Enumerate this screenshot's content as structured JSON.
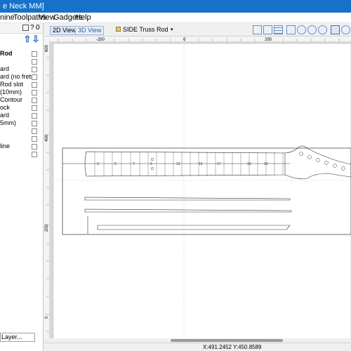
{
  "window": {
    "title": "e Neck MM]"
  },
  "menu": {
    "items": [
      "nine",
      "Toolpaths",
      "View",
      "Gadgets",
      "Help"
    ]
  },
  "sidebar": {
    "toolbar_question": "?",
    "toolbar_icon2": "0",
    "up_arrow": "⇧",
    "down_arrow": "⇩",
    "layers": [
      "Rod",
      "",
      "ard",
      "ard (no frets)",
      "Rod slot",
      "(10mm)",
      "Contour",
      "ock",
      "ard",
      "5mm)",
      "",
      "",
      "line",
      ""
    ],
    "bottom_button": "Layer..."
  },
  "view": {
    "tabs": [
      "2D View",
      "3D View"
    ],
    "layer_select": "SIDE Truss Rod"
  },
  "ruler": {
    "top_labels": [
      "-200",
      "0",
      "200"
    ],
    "left_labels": [
      "600",
      "400",
      "200",
      "0"
    ]
  },
  "fretboard": {
    "fret_numbers": [
      "3",
      "5",
      "7",
      "9",
      "12",
      "15",
      "17",
      "19",
      "21"
    ]
  },
  "status": {
    "coords": "X:491.2452 Y:450.8589"
  },
  "colors": {
    "titlebar": "#1672c8",
    "canvas": "#d8d8d8",
    "page": "#ffffff"
  }
}
